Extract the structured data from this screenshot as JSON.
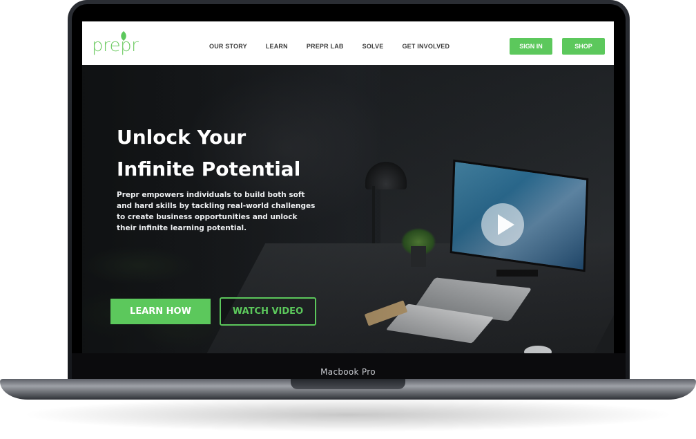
{
  "device": {
    "model_label": "Macbook Pro"
  },
  "header": {
    "logo_text": "prepr",
    "nav": [
      "OUR STORY",
      "LEARN",
      "PREPR LAB",
      "SOLVE",
      "GET INVOLVED"
    ],
    "sign_in_label": "SIGN IN",
    "shop_label": "SHOP"
  },
  "hero": {
    "title_line1": "Unlock Your",
    "title_line2": "Infinite Potential",
    "description": "Prepr empowers individuals to build both soft and hard skills by tackling real-world challenges to create business opportunities and unlock their infinite learning potential.",
    "learn_how_label": "LEARN HOW",
    "watch_video_label": "WATCH VIDEO",
    "play_icon": "play-icon"
  },
  "colors": {
    "brand_green": "#5cc85c",
    "logo_green": "#6ecb63",
    "nav_text": "#3a3a3a"
  }
}
